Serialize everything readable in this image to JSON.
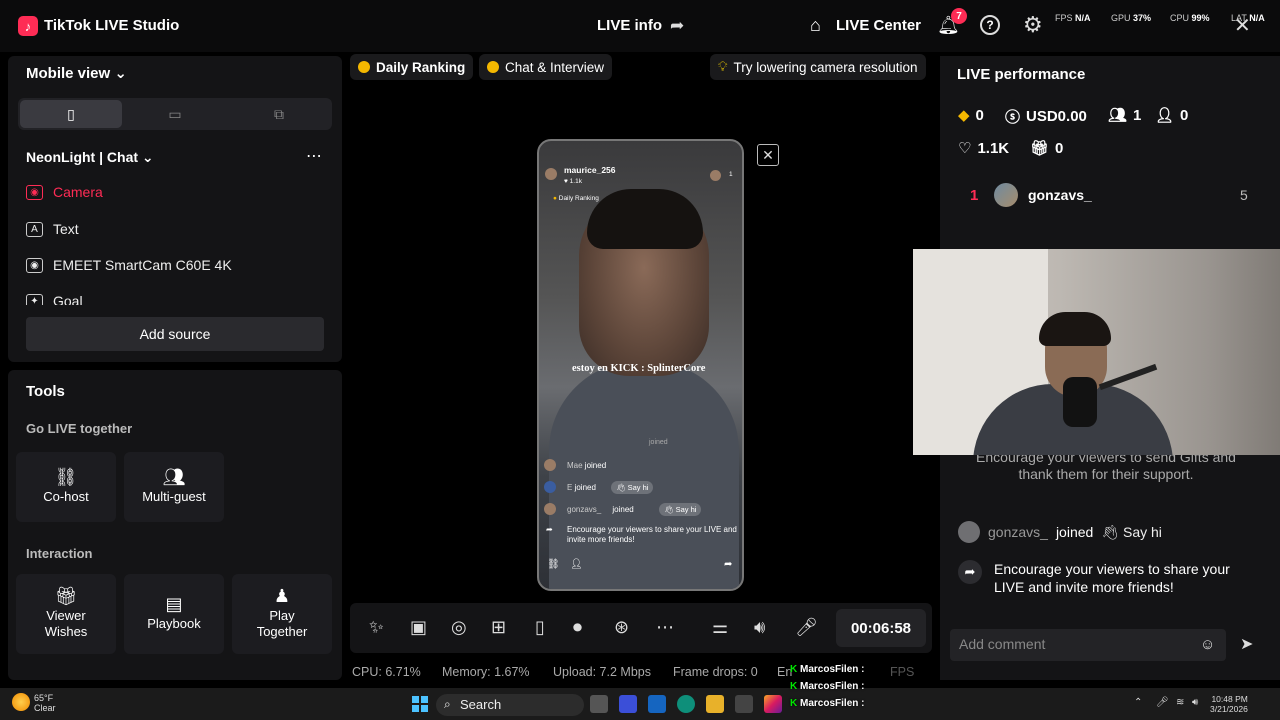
{
  "app": {
    "title": "TikTok LIVE Studio",
    "live_info": "LIVE info",
    "live_center": "LIVE Center",
    "notification_count": "7",
    "help_glyph": "?",
    "stats": [
      {
        "label": "FPS",
        "value": "N/A"
      },
      {
        "label": "GPU",
        "value": "37%"
      },
      {
        "label": "CPU",
        "value": "99%"
      },
      {
        "label": "LAT",
        "value": "N/A"
      }
    ]
  },
  "left": {
    "view_label": "Mobile view",
    "scene_name": "NeonLight | Chat",
    "sources": [
      {
        "label": "Camera",
        "icon": "camera-icon",
        "active": true
      },
      {
        "label": "Text",
        "icon": "text-icon",
        "active": false
      },
      {
        "label": "EMEET SmartCam C60E 4K",
        "icon": "camera-icon",
        "active": false
      },
      {
        "label": "Goal",
        "icon": "goal-icon",
        "active": false
      }
    ],
    "add_source": "Add source",
    "tools_title": "Tools",
    "go_live_title": "Go LIVE together",
    "go_live_tools": [
      {
        "label": "Co-host",
        "icon": "link-icon"
      },
      {
        "label": "Multi-guest",
        "icon": "users-icon"
      }
    ],
    "interaction_title": "Interaction",
    "interaction_tools": [
      {
        "label": "Viewer Wishes",
        "icon": "wishes-icon"
      },
      {
        "label": "Playbook",
        "icon": "playbook-icon"
      },
      {
        "label": "Play Together",
        "icon": "play-together-icon"
      }
    ]
  },
  "center": {
    "chips": [
      "Daily Ranking",
      "Chat & Interview"
    ],
    "tip": "Try lowering camera resolution",
    "phone": {
      "username": "maurice_256",
      "likes": "1.1k",
      "ranking": "Daily Ranking",
      "viewer_count": "1",
      "overlay_text": "estoy en KICK : SplinterCore",
      "joined_line": "joined",
      "events": [
        {
          "name": "Mae",
          "action": "joined",
          "say_hi": ""
        },
        {
          "name": "E",
          "action": "joined",
          "say_hi": "Say hi"
        },
        {
          "name": "gonzavs_",
          "action": "joined",
          "say_hi": "Say hi"
        }
      ],
      "encourage": "Encourage your viewers to share your LIVE and invite more friends!"
    },
    "timer": "00:06:58",
    "status": {
      "cpu": "CPU: 6.71%",
      "memory": "Memory: 1.67%",
      "upload": "Upload: 7.2 Mbps",
      "frame_drops": "Frame drops: 0",
      "extra": "En",
      "fps": "FPS"
    }
  },
  "right": {
    "title": "LIVE performance",
    "diamonds": "0",
    "usd": "USD0.00",
    "viewers": "1",
    "new_followers": "0",
    "likes": "1.1K",
    "gifts": "0",
    "ranking": [
      {
        "rank": "1",
        "name": "gonzavs_",
        "value": "5"
      }
    ],
    "gift_prompt": "Encourage your viewers to send Gifts and thank them for their support.",
    "join_event": {
      "name": "gonzavs_",
      "action": "joined",
      "say_hi": "Say hi"
    },
    "share_prompt": "Encourage your viewers to share your LIVE and invite more friends!",
    "comment_placeholder": "Add comment"
  },
  "taskbar": {
    "weather_temp": "65°F",
    "weather_desc": "Clear",
    "search": "Search",
    "time": "10:48 PM",
    "date": "3/21/2026",
    "overlay_user": "MarcosFilen :"
  },
  "colors": {
    "accent": "#fe2c55",
    "panel": "#141416",
    "background": "#000000",
    "gold": "#f5b800"
  }
}
